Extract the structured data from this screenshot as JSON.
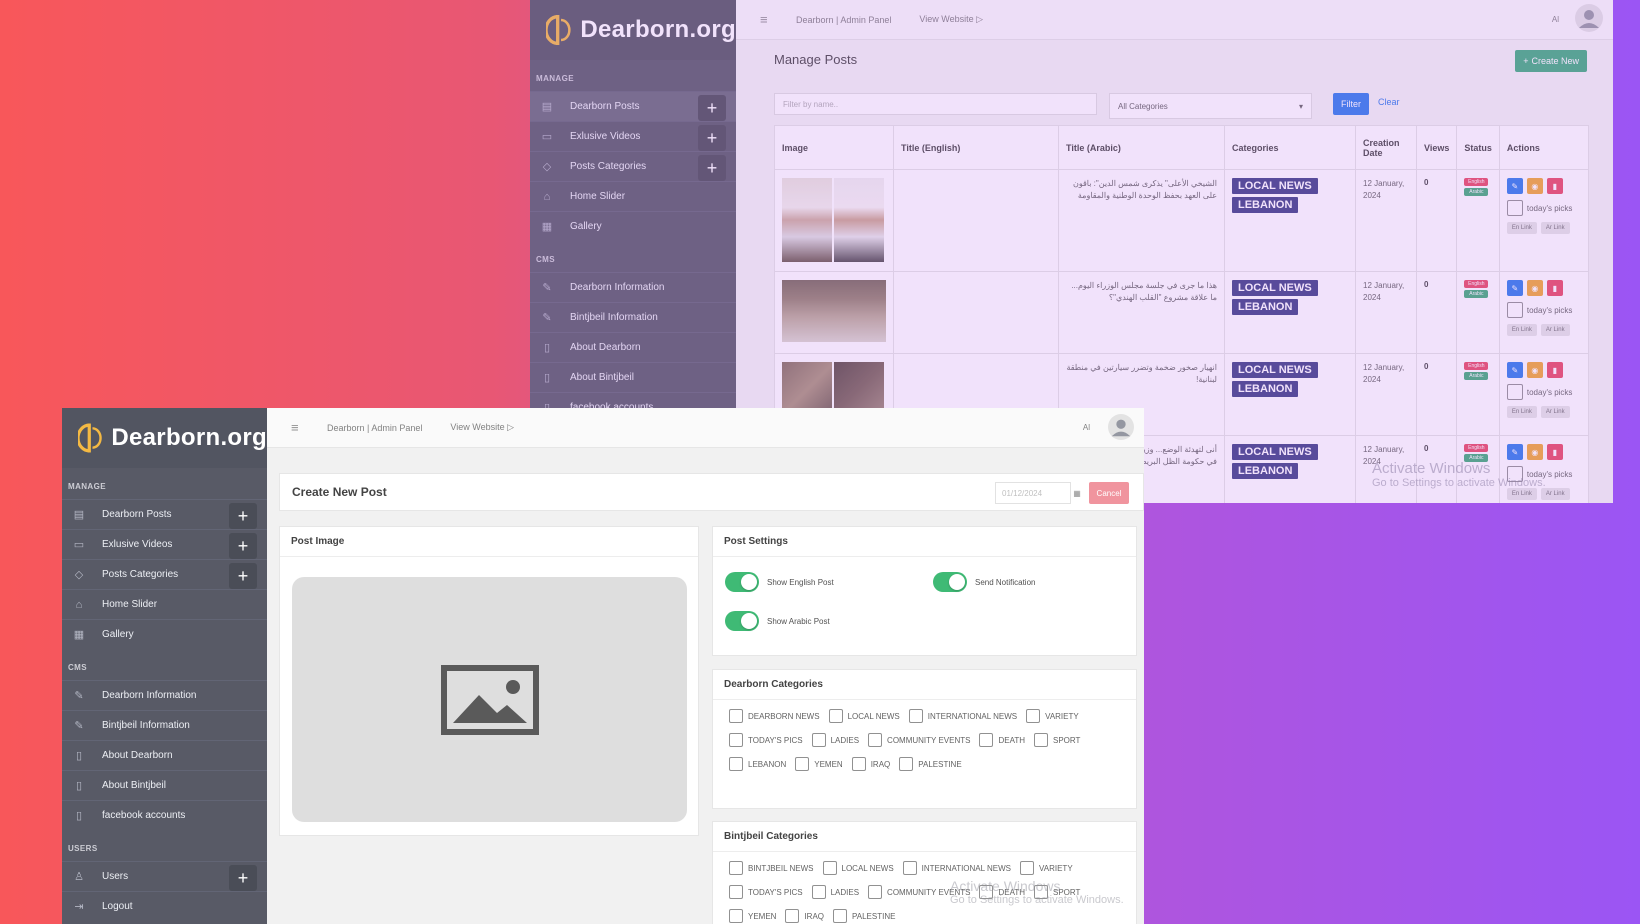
{
  "brand": {
    "name": "Dearborn.org",
    "colors": {
      "logo_gold": "#f3b433",
      "sidebar": "#4a4d5a",
      "accent_green": "#2fa774",
      "accent_blue": "#1b6fe9",
      "danger": "#e63a55",
      "tag_navy": "#2c2f7a"
    }
  },
  "sidebar": {
    "manage_title": "MANAGE",
    "cms_title": "CMS",
    "users_title": "USERS",
    "manage_items": [
      {
        "label": "Dearborn Posts",
        "icon": "newspaper-icon",
        "has_add": true
      },
      {
        "label": "Exlusive Videos",
        "icon": "video-icon",
        "has_add": true
      },
      {
        "label": "Posts Categories",
        "icon": "tag-icon",
        "has_add": true
      },
      {
        "label": "Home Slider",
        "icon": "home-icon",
        "has_add": false
      },
      {
        "label": "Gallery",
        "icon": "grid-icon",
        "has_add": false
      }
    ],
    "cms_items": [
      {
        "label": "Dearborn Information",
        "icon": "pencil-icon"
      },
      {
        "label": "Bintjbeil Information",
        "icon": "pencil-icon"
      },
      {
        "label": "About Dearborn",
        "icon": "info-icon"
      },
      {
        "label": "About Bintjbeil",
        "icon": "info-icon"
      },
      {
        "label": "facebook accounts",
        "icon": "info-icon"
      }
    ],
    "users_items": [
      {
        "label": "Users",
        "icon": "user-icon",
        "has_add": true
      },
      {
        "label": "Logout",
        "icon": "logout-icon",
        "has_add": false
      }
    ],
    "add_symbol": "+"
  },
  "topbar": {
    "admin_panel": "Dearborn | Admin Panel",
    "view_website": "View Website",
    "user_initial": "Al",
    "hamburger": "≡"
  },
  "manage_posts": {
    "title": "Manage Posts",
    "create_button": "Create New",
    "filter_placeholder": "Filter by name..",
    "category_select": "All Categories",
    "filter_button": "Filter",
    "clear_link": "Clear",
    "columns": [
      "Image",
      "Title (English)",
      "Title (Arabic)",
      "Categories",
      "Creation Date",
      "Views",
      "Status",
      "Actions"
    ],
    "rows": [
      {
        "title_en": "",
        "title_ar": "الشيخي الأعلى\" يذكرى شمس الدين\": باقون على العهد بحفظ الوحدة الوطنية والمقاومة",
        "categories": [
          "LOCAL NEWS",
          "LEBANON"
        ],
        "date": "12 January, 2024",
        "views": "0",
        "status": [
          "English",
          "Arabic"
        ],
        "todays_picks": "today's picks",
        "links": [
          "En Link",
          "Ar Link"
        ]
      },
      {
        "title_en": "",
        "title_ar": "هذا ما جرى في جلسة مجلس الوزراء اليوم... ما علاقة مشروع \"القلب الهندي\"؟",
        "categories": [
          "LOCAL NEWS",
          "LEBANON"
        ],
        "date": "12 January, 2024",
        "views": "0",
        "status": [
          "English",
          "Arabic"
        ],
        "todays_picks": "today's picks",
        "links": [
          "En Link",
          "Ar Link"
        ]
      },
      {
        "title_en": "",
        "title_ar": "انهيار صخور ضخمة وتضرر سيارتين في منطقة لبنانية!",
        "categories": [
          "LOCAL NEWS",
          "LEBANON"
        ],
        "date": "12 January, 2024",
        "views": "0",
        "status": [
          "English",
          "Arabic"
        ],
        "todays_picks": "today's picks",
        "links": [
          "En Link",
          "Ar Link"
        ]
      },
      {
        "title_en": "",
        "title_ar": "أنى لتهدئة الوضع... وزير الخارجية النقي: وزيراً في حكومة الظل البريطانية",
        "categories": [
          "LOCAL NEWS",
          "LEBANON"
        ],
        "date": "12 January, 2024",
        "views": "0",
        "status": [
          "English",
          "Arabic"
        ],
        "todays_picks": "today's picks",
        "links": [
          "En Link",
          "Ar Link"
        ]
      }
    ]
  },
  "create_post": {
    "title": "Create New Post",
    "date_value": "01/12/2024",
    "cancel_button": "Cancel",
    "post_image_title": "Post Image",
    "settings_title": "Post Settings",
    "toggles": {
      "show_english": "Show English Post",
      "send_notification": "Send Notification",
      "show_arabic": "Show Arabic Post"
    },
    "dearborn_title": "Dearborn Categories",
    "dearborn_categories": [
      [
        "DEARBORN NEWS",
        "LOCAL NEWS",
        "INTERNATIONAL NEWS",
        "VARIETY"
      ],
      [
        "TODAY'S PICS",
        "LADIES",
        "COMMUNITY EVENTS",
        "DEATH",
        "SPORT"
      ],
      [
        "LEBANON",
        "YEMEN",
        "IRAQ",
        "PALESTINE"
      ]
    ],
    "bintjbeil_title": "Bintjbeil Categories",
    "bintjbeil_categories": [
      [
        "BINTJBEIL NEWS",
        "LOCAL NEWS",
        "INTERNATIONAL NEWS",
        "VARIETY"
      ],
      [
        "TODAY'S PICS",
        "LADIES",
        "COMMUNITY EVENTS",
        "DEATH",
        "SPORT"
      ],
      [
        "YEMEN",
        "IRAQ",
        "PALESTINE"
      ]
    ]
  },
  "watermark": {
    "line1": "Activate Windows",
    "line2": "Go to Settings to activate Windows."
  }
}
